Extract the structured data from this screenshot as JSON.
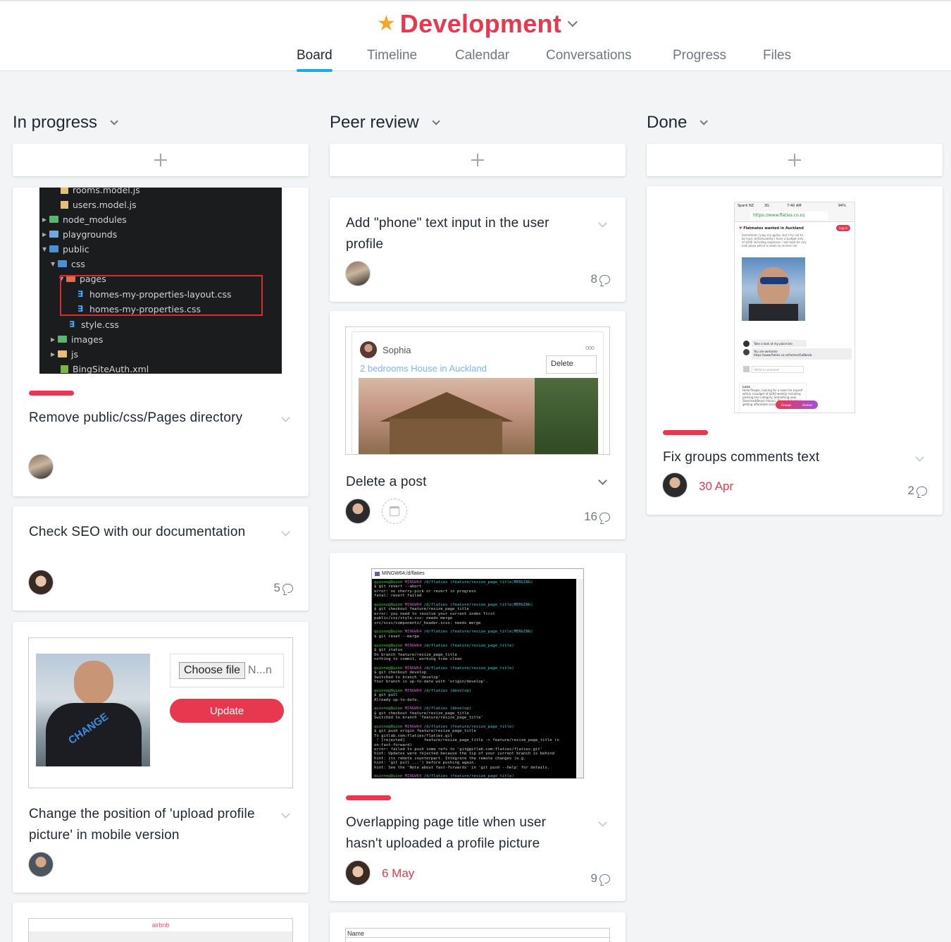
{
  "project": {
    "title": "Development",
    "star_color": "#f5a623",
    "title_color": "#e8384f"
  },
  "tabs": [
    {
      "label": "Board",
      "active": true
    },
    {
      "label": "Timeline"
    },
    {
      "label": "Calendar"
    },
    {
      "label": "Conversations"
    },
    {
      "label": "Progress"
    },
    {
      "label": "Files"
    }
  ],
  "columns": [
    {
      "title": "In progress",
      "cards": [
        {
          "title": "Remove public/css/Pages directory",
          "tag_color": "#e8384f",
          "image": {
            "tree": [
              "rooms.model.js",
              "users.model.js",
              "node_modules",
              "playgrounds",
              "public",
              "css",
              "pages",
              "homes-my-properties-layout.css",
              "homes-my-properties.css",
              "style.css",
              "images",
              "js",
              "BingSiteAuth.xml"
            ]
          }
        },
        {
          "title": "Check SEO with our documentation",
          "comments": "5"
        },
        {
          "title": "Change the position of 'upload profile picture' in mobile version",
          "image": {
            "choose_file": "Choose file",
            "file_name": "N...n",
            "update_button": "Update",
            "shirt_text": "CHANGE"
          }
        },
        {
          "image": {
            "brand": "airbnb"
          }
        }
      ]
    },
    {
      "title": "Peer review",
      "cards": [
        {
          "title": "Add \"phone\" text input in the user profile",
          "comments": "8"
        },
        {
          "title": "Delete a post",
          "comments": "16",
          "image": {
            "user": "Sophia",
            "link": "2 bedrooms House in Auckland",
            "menu_item": "Delete",
            "dots": "ooo"
          }
        },
        {
          "title": "Overlapping page title when user hasn't uploaded a profile picture",
          "tag_color": "#e8384f",
          "due": "6 May",
          "comments": "9",
          "image": {
            "window_title": "MINGW64:/d/flaties",
            "lines": [
              "quinnn@Quinn MINGW64 /d/flaties (feature/resize_page_title|MERGING)",
              "$ git revert --abort",
              "error: no cherry-pick or revert in progress",
              "fatal: revert failed",
              "",
              "quinnn@Quinn MINGW64 /d/flaties (feature/resize_page_title|MERGING)",
              "$ git checkout feature/resize_page_title",
              "error: you need to resolve your current index first",
              "public/css/style.css: needs merge",
              "src/scss/components/_header.scss: needs merge",
              "",
              "quinnn@Quinn MINGW64 /d/flaties (feature/resize_page_title|MERGING)",
              "$ git reset --merge",
              "",
              "quinnn@Quinn MINGW64 /d/flaties (feature/resize_page_title)",
              "$ git status",
              "On branch feature/resize_page_title",
              "nothing to commit, working tree clean",
              "",
              "quinnn@Quinn MINGW64 /d/flaties (feature/resize_page_title)",
              "$ git checkout develop",
              "Switched to branch 'develop'",
              "Your branch is up-to-date with 'origin/develop'.",
              "",
              "quinnn@Quinn MINGW64 /d/flaties (develop)",
              "$ git pull",
              "Already up-to-date.",
              "",
              "quinnn@Quinn MINGW64 /d/flaties (develop)",
              "$ git checkout feature/resize_page_title",
              "Switched to branch 'feature/resize_page_title'",
              "",
              "quinnn@Quinn MINGW64 /d/flaties (feature/resize_page_title)",
              "$ git push origin feature/resize_page_title",
              "To gitlab.com:flaties/flaties.git",
              " ! [rejected]        feature/resize_page_title -> feature/resize_page_title (n",
              "on-fast-forward)",
              "error: failed to push some refs to 'git@gitlab.com:flaties/flaties.git'",
              "hint: Updates were rejected because the tip of your current branch is behind",
              "hint: its remote counterpart. Integrate the remote changes (e.g.",
              "hint: 'git pull ...') before pushing again.",
              "hint: See the 'Note about fast-forwards' in 'git push --help' for details.",
              "",
              "quinnn@Quinn MINGW64 /d/flaties (feature/resize_page_title)",
              "$ |"
            ]
          }
        },
        {
          "image": {
            "field_label": "Name"
          }
        }
      ]
    },
    {
      "title": "Done",
      "cards": [
        {
          "title": "Fix groups comments text",
          "tag_color": "#e8384f",
          "due": "30 Apr",
          "comments": "2",
          "image": {
            "carrier": "Spark NZ",
            "network": "3G",
            "time": "7:40 AM",
            "battery": "94%",
            "url": "https://www.flaties.co.nz",
            "post_title": "Flatmates wanted in Auckland",
            "login": "Log in",
            "post_body": "Sometimes I play my guitar, but I try not to be loud. Unfortunately I have a budget only of $200 including expenses. I will wait for any cool place which is seem to receive me",
            "c1": "Take a look at my place bro",
            "c2": "You are welcome",
            "c2_link": "https://www.flaties.co.nz/homes/5a8bacb",
            "write": "Write a comment",
            "c3_name": "Lana",
            "c3": "Hello People, looking for a room for myself within a budget of $200 weekly including parking one category. Something near Stanhead/Beach Haven. Please help me in getting affordable accommodation",
            "pill_groups": "Groups",
            "pill_homes": "Homes"
          }
        }
      ]
    }
  ]
}
